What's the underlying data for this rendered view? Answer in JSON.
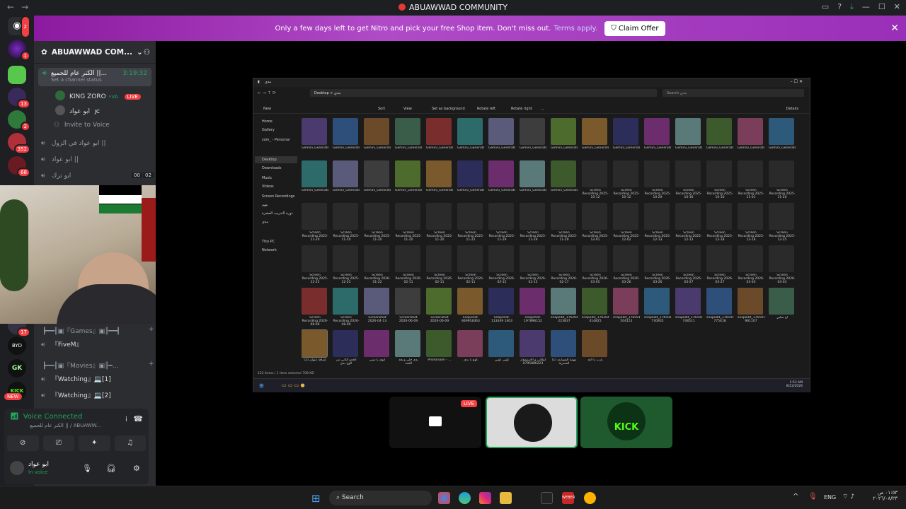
{
  "window": {
    "title": "ABUAWWAD COMMUNITY"
  },
  "nitro": {
    "message": "Only a few days left to get Nitro and pick your free Shop item. Don't miss out.",
    "link": "Terms apply.",
    "claim_label": "Claim Offer"
  },
  "server_badges": [
    "2",
    "1",
    "13",
    "2",
    "352",
    "68",
    "17",
    "NEW"
  ],
  "guild": {
    "name": "ABUAWWAD COM..."
  },
  "channels": {
    "active_voice": {
      "name": "الكنر عام للجميع ||...",
      "timer": "3:19:32",
      "status": "Set a channel status"
    },
    "members": [
      {
        "name": "KING ZORO",
        "tag": "LIVE"
      },
      {
        "name": "ابو عواد",
        "tag": "JC"
      }
    ],
    "invite": "Invite to Voice",
    "voice_list": [
      "ابو عواد في الزول ||",
      "ابو عواد ||",
      "ابو ترك"
    ],
    "voice_list_counts": [
      "00",
      "02"
    ],
    "lower": [
      {
        "label": "┣━━╢▣『Games』▣╟━━┫"
      },
      {
        "label": "『FiveM』"
      },
      {
        "label": "┣━━╢▣『Movies』▣╟━..."
      },
      {
        "label": "『Watching』💻[1]"
      },
      {
        "label": "『Watching』💻[2]"
      }
    ]
  },
  "voice_panel": {
    "status": "Voice Connected",
    "channel": "الكنر عام للجميع || / ABUAWW..."
  },
  "user": {
    "name": "ابو عواد",
    "status": "In voice"
  },
  "explorer": {
    "title": "بندي",
    "path": "Desktop  >  بندي",
    "search_placeholder": "Search بندي",
    "toolbar": [
      "New",
      "Sort",
      "View",
      "Set as background",
      "Rotate left",
      "Rotate right",
      "...",
      "Details"
    ],
    "sidebar": [
      "Home",
      "Gallery",
      "zom_ - Personal",
      "Desktop",
      "Downloads",
      "Music",
      "Videos",
      "Screen Recordings",
      "مهم",
      "دورة التدريب العشرة",
      "بندي",
      "This PC",
      "Network"
    ],
    "rows": [
      [
        "Gemini_Generated_Image_53xzu",
        "Gemini_Generated_Image_78w",
        "Gemini_Generated_Image_283",
        "Gemini_Generated_Image_40ae",
        "Gemini_Generated_Image_a4v",
        "Gemini_Generated_Image_bgy",
        "Gemini_Generated_Image_dpd",
        "Gemini_Generated_Image_dub",
        "Gemini_Generated_Image_ezg",
        "Gemini_Generated_Image_fhy",
        "Gemini_Generated_Image_fk",
        "Gemini_Generated_Image_hao",
        "Gemini_Generated_Image_hg1",
        "Gemini_Generated_Image_hx",
        "Gemini_Generated_Image_j47",
        "Gemini_Generated_Image_ov2"
      ],
      [
        "Gemini_Generated_Image_p8g",
        "Gemini_Generated_Image_pb1",
        "Gemini_Generated_Image_pon",
        "Gemini_Generated_Image_qtq",
        "Gemini_Generated_Image_tq3",
        "Gemini_Generated_Image_uvg",
        "Gemini_Generated_Image_wfd",
        "Gemini_Generated_Image_ybs",
        "Gemini_Generated_Image_zbt",
        "Screen Recording 2025-10-12",
        "Screen Recording 2025-10-12",
        "Screen Recording 2025-10-29",
        "Screen Recording 2025-10-30",
        "Screen Recording 2025-10-30",
        "Screen Recording 2025-11-01",
        "Screen Recording 2025-11-20"
      ],
      [
        "Screen Recording 2025-11-20",
        "Screen Recording 2025-11-20",
        "Screen Recording 2025-11-20",
        "Screen Recording 2025-11-20",
        "Screen Recording 2025-11-20",
        "Screen Recording 2025-11-22",
        "Screen Recording 2025-11-29",
        "Screen Recording 2025-11-29",
        "Screen Recording 2025-11-29",
        "Screen Recording 2025-12-01",
        "Screen Recording 2025-12-02",
        "Screen Recording 2025-12-13",
        "Screen Recording 2025-12-13",
        "Screen Recording 2025-12-18",
        "Screen Recording 2025-12-18",
        "Screen Recording 2025-12-25"
      ],
      [
        "Screen Recording 2025-12-25",
        "Screen Recording 2025-12-25",
        "Screen Recording 2026-01-22",
        "Screen Recording 2026-02-11",
        "Screen Recording 2026-02-11",
        "Screen Recording 2026-02-11",
        "Screen Recording 2026-02-15",
        "Screen Recording 2026-02-15",
        "Screen Recording 2026-02-17",
        "Screen Recording 2026-03-05",
        "Screen Recording 2026-03-26",
        "Screen Recording 2026-03-26",
        "Screen Recording 2026-03-27",
        "Screen Recording 2026-03-27",
        "Screen Recording 2026-03-30",
        "Screen Recording 2026-04-03"
      ],
      [
        "Screen Recording 2026-08-09",
        "Screen Recording 2026-08-09",
        "Screenshot 2026-04-13",
        "Screenshot 2026-06-09",
        "Screenshot 2026-06-09",
        "Snapchat-849918363",
        "Snapchat-113349 1403",
        "Snapchat-197896152",
        "snapedit_1762043 223837",
        "snapedit_1762043 414825",
        "snapedit_1765911 504151",
        "snapedit_1765911 730835",
        "snapedit_1765911 748511",
        "snapedit_1765911 775418",
        "snapedit_1765912 961107",
        "اج سلبي"
      ],
      [
        "(2) إضافة عنوان",
        "الحدو الثاني من الوح بدي",
        "انوي يا سني",
        "بدي حلي و بعد الحث",
        "Photoroom - ...",
        "كوم با بدي",
        "كوني كوني",
        "لطالب و الاستشفار 0795886223",
        "مهمة السواري (1) الصدرية",
        "يارب يا الله"
      ]
    ],
    "status": "122 items  |  1 item selected 708 KB",
    "clock": "1:53 AM\n8/23/2026"
  },
  "participants": {
    "live_label": "LIVE"
  },
  "taskbar": {
    "search": "Search",
    "lang": "ENG",
    "time": "٠١:٥٣ ص",
    "date": "٢٠٢٦/٠٨/٢٣",
    "dropdown_hint": "WEBER"
  }
}
